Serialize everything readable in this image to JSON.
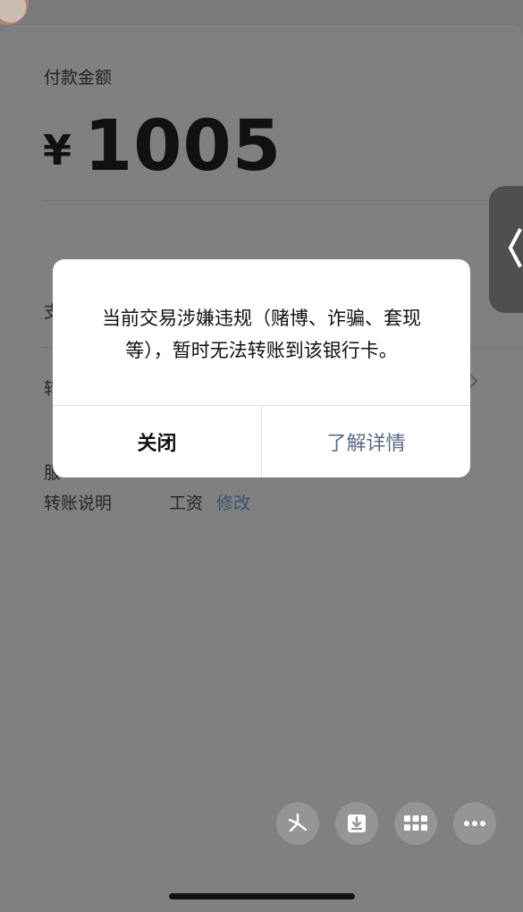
{
  "payment": {
    "amount_label": "付款金额",
    "currency_symbol": "¥",
    "amount": "1005"
  },
  "rows": {
    "row1_label_partial": "支",
    "row2_label_partial": "转",
    "row3_label_partial": "服",
    "note_label": "转账说明",
    "note_value": "工资",
    "note_edit_link": "修改"
  },
  "side_handle": {
    "glyph": "〈"
  },
  "dialog": {
    "message": "当前交易涉嫌违规（赌博、诈骗、套现等），暂时无法转账到该银行卡。",
    "close_label": "关闭",
    "detail_label": "了解详情"
  },
  "colors": {
    "overlay": "#808080",
    "link": "#586a8c",
    "dialog_bg": "#ffffff"
  },
  "floating_buttons": [
    {
      "name": "pinwheel-icon"
    },
    {
      "name": "download-box-icon"
    },
    {
      "name": "grid-icon"
    },
    {
      "name": "more-dots-icon"
    }
  ]
}
